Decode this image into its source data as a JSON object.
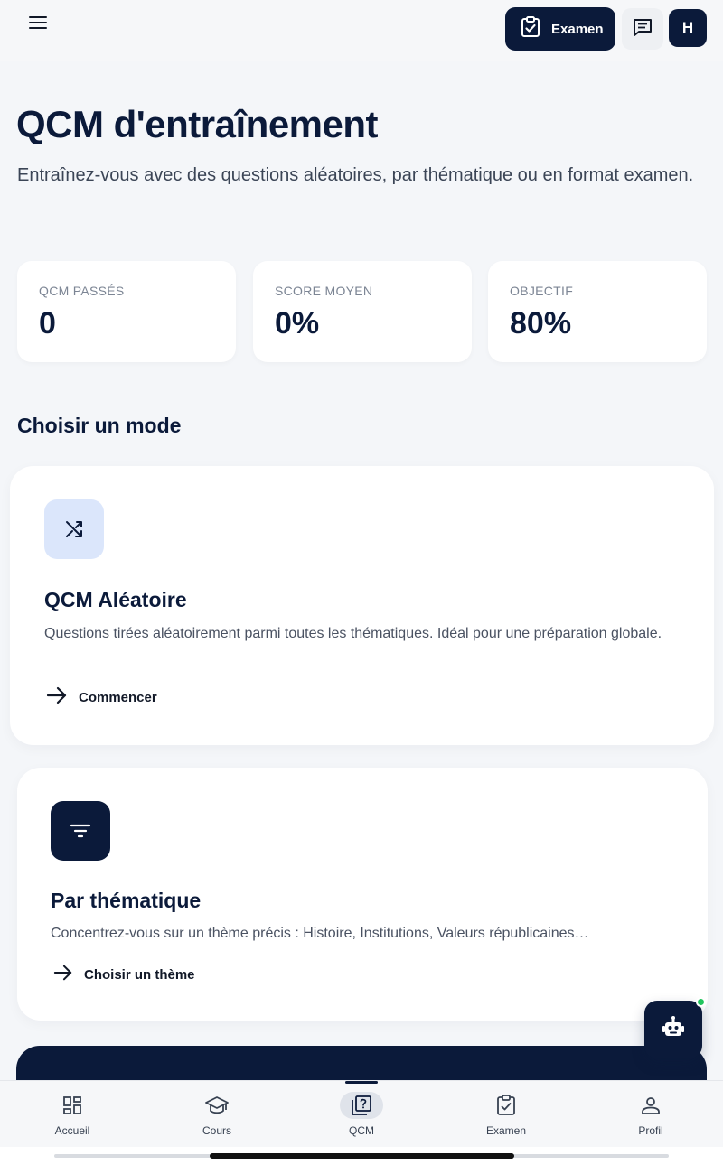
{
  "header": {
    "exam_label": "Examen",
    "avatar_initial": "H"
  },
  "page": {
    "title": "QCM d'entraînement",
    "subtitle": "Entraînez-vous avec des questions aléatoires, par thématique ou en format examen."
  },
  "stats": [
    {
      "label": "QCM PASSÉS",
      "value": "0"
    },
    {
      "label": "SCORE MOYEN",
      "value": "0%"
    },
    {
      "label": "OBJECTIF",
      "value": "80%"
    }
  ],
  "modes_section_title": "Choisir un mode",
  "modes": [
    {
      "icon": "shuffle-icon",
      "title": "QCM Aléatoire",
      "description": "Questions tirées aléatoirement parmi toutes les thématiques. Idéal pour une préparation globale.",
      "action": "Commencer"
    },
    {
      "icon": "filter-icon",
      "title": "Par thématique",
      "description": "Concentrez-vous sur un thème précis : Histoire, Institutions, Valeurs républicaines…",
      "action": "Choisir un thème"
    }
  ],
  "bottom_nav": [
    {
      "label": "Accueil",
      "icon": "dashboard-icon"
    },
    {
      "label": "Cours",
      "icon": "graduation-cap-icon"
    },
    {
      "label": "QCM",
      "icon": "quiz-icon",
      "active": true
    },
    {
      "label": "Examen",
      "icon": "clipboard-check-icon"
    },
    {
      "label": "Profil",
      "icon": "person-icon"
    }
  ],
  "colors": {
    "navy": "#0b1a3a",
    "background": "#f4f6f9",
    "shuffle_tile": "#dbe6fb",
    "online_dot": "#22c55e"
  }
}
